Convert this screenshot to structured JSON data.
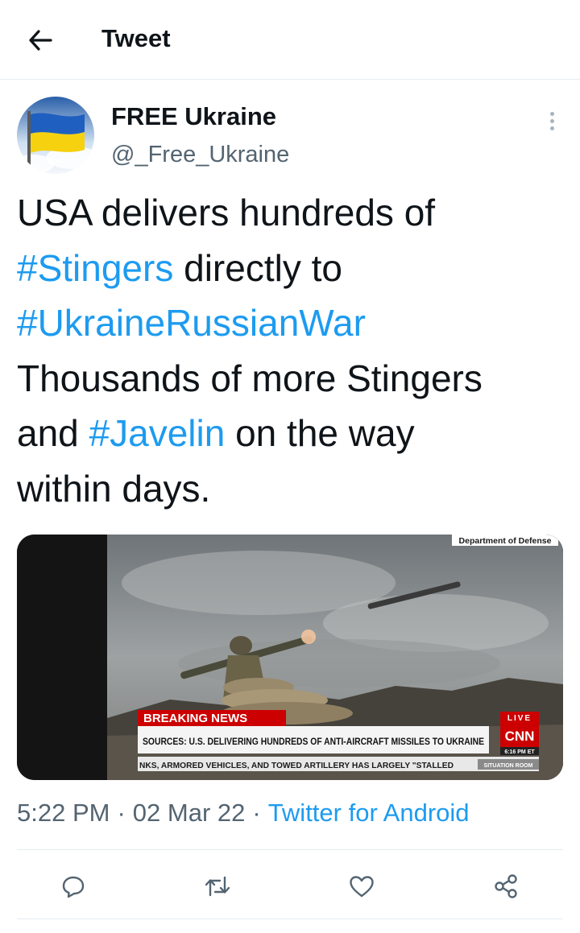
{
  "header": {
    "title": "Tweet",
    "back_icon": "arrow-left-icon"
  },
  "author": {
    "display_name": "FREE Ukraine",
    "handle": "@_Free_Ukraine",
    "avatar_icon": "ukraine-flag-avatar"
  },
  "tweet": {
    "lines": [
      [
        {
          "text": "USA delivers hundreds of",
          "hashtag": false
        }
      ],
      [
        {
          "text": "#Stingers",
          "hashtag": true
        },
        {
          "text": " directly to",
          "hashtag": false
        }
      ],
      [
        {
          "text": "#UkraineRussianWar",
          "hashtag": true
        }
      ],
      [
        {
          "text": "Thousands of more Stingers",
          "hashtag": false
        }
      ],
      [
        {
          "text": "and ",
          "hashtag": false
        },
        {
          "text": "#Javelin",
          "hashtag": true
        },
        {
          "text": " on the way",
          "hashtag": false
        }
      ],
      [
        {
          "text": "within days.",
          "hashtag": false
        }
      ]
    ],
    "media": {
      "dod_tag": "Department of Defense",
      "breaking_label": "BREAKING NEWS",
      "live_label": "LIVE",
      "headline": "SOURCES: U.S. DELIVERING HUNDREDS OF ANTI-AIRCRAFT MISSILES TO UKRAINE",
      "network": "CNN",
      "time": "6:16 PM ET",
      "ticker": "NKS, ARMORED VEHICLES, AND TOWED ARTILLERY HAS LARGELY \"STALLED",
      "show": "SITUATION ROOM"
    },
    "time": "5:22 PM",
    "date": "02 Mar 22",
    "separator": "·",
    "source": "Twitter for Android"
  },
  "actions": [
    {
      "name": "reply-button",
      "icon": "speech-bubble-icon"
    },
    {
      "name": "retweet-button",
      "icon": "retweet-icon"
    },
    {
      "name": "like-button",
      "icon": "heart-icon"
    },
    {
      "name": "share-button",
      "icon": "share-icon"
    }
  ],
  "colors": {
    "accent": "#1d9bf0",
    "text": "#0f1419",
    "secondary": "#536471",
    "border": "#e6ecf0",
    "cnn_red": "#cc0000"
  }
}
